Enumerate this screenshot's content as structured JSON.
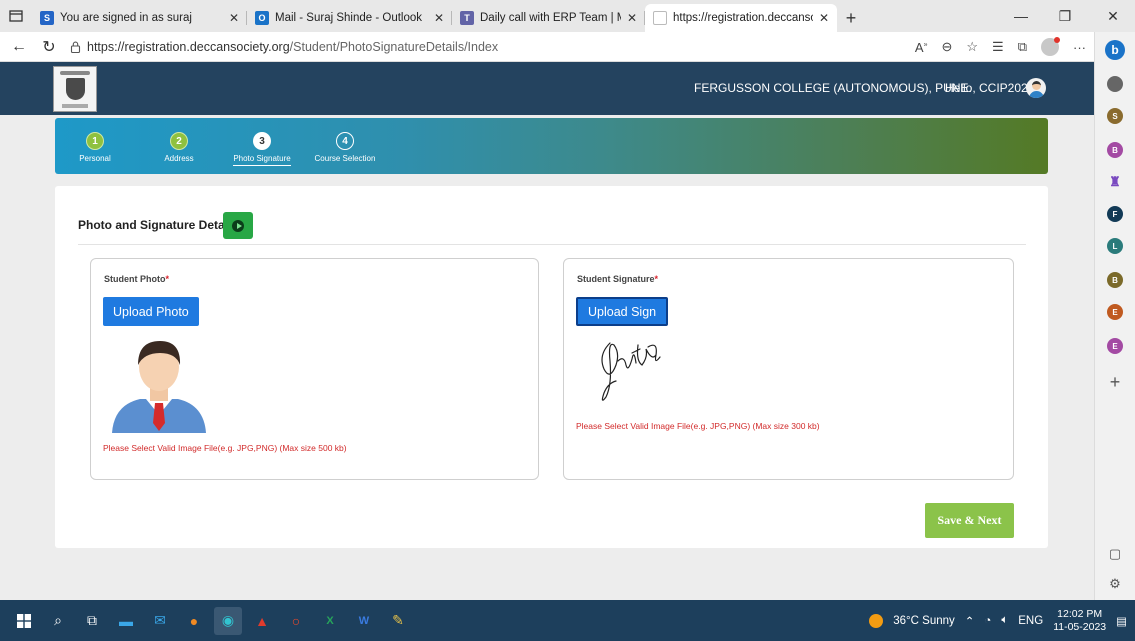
{
  "browser": {
    "tabs": [
      {
        "title": "You are signed in as suraj",
        "favicon": "S",
        "favicon_color": "#2465c6",
        "active": false
      },
      {
        "title": "Mail - Suraj Shinde - Outlook",
        "favicon": "O",
        "favicon_color": "#1a73c8",
        "active": false
      },
      {
        "title": "Daily call with ERP Team | Micros",
        "favicon": "T",
        "favicon_color": "#6264a7",
        "active": false
      },
      {
        "title": "https://registration.deccansociety",
        "favicon": "",
        "favicon_color": "#cfcfcf",
        "active": true
      }
    ],
    "url_base": "https://registration.deccansociety.org",
    "url_path": "/Student/PhotoSignatureDetails/Index",
    "edge_profile_letters": [
      "S",
      "B",
      "F",
      "L",
      "B",
      "E",
      "E"
    ]
  },
  "header": {
    "college_name": "FERGUSSON COLLEGE (AUTONOMOUS), PUNE.",
    "greeting": "Hello, CCIP2023"
  },
  "steps": [
    {
      "number": "1",
      "label": "Personal",
      "state": "done"
    },
    {
      "number": "2",
      "label": "Address",
      "state": "done"
    },
    {
      "number": "3",
      "label": "Photo Signature",
      "state": "active"
    },
    {
      "number": "4",
      "label": "Course Selection",
      "state": "todo"
    }
  ],
  "section": {
    "title": "Photo and Signature Details"
  },
  "photo_panel": {
    "label": "Student Photo",
    "required_mark": "*",
    "button": "Upload Photo",
    "error": "Please Select Valid Image File(e.g. JPG,PNG) (Max size 500 kb)"
  },
  "sign_panel": {
    "label": "Student Signature",
    "required_mark": "*",
    "button": "Upload Sign",
    "error": "Please Select Valid Image File(e.g. JPG,PNG) (Max size 300 kb)"
  },
  "save_button": "Save & Next",
  "taskbar": {
    "weather": "36°C Sunny",
    "language": "ENG",
    "time": "12:02 PM",
    "date": "11-05-2023"
  },
  "colors": {
    "header_bg": "#24435f",
    "upload_btn": "#1f7ae0",
    "save_btn": "#8bc34a",
    "error_text": "#d22b2b"
  }
}
